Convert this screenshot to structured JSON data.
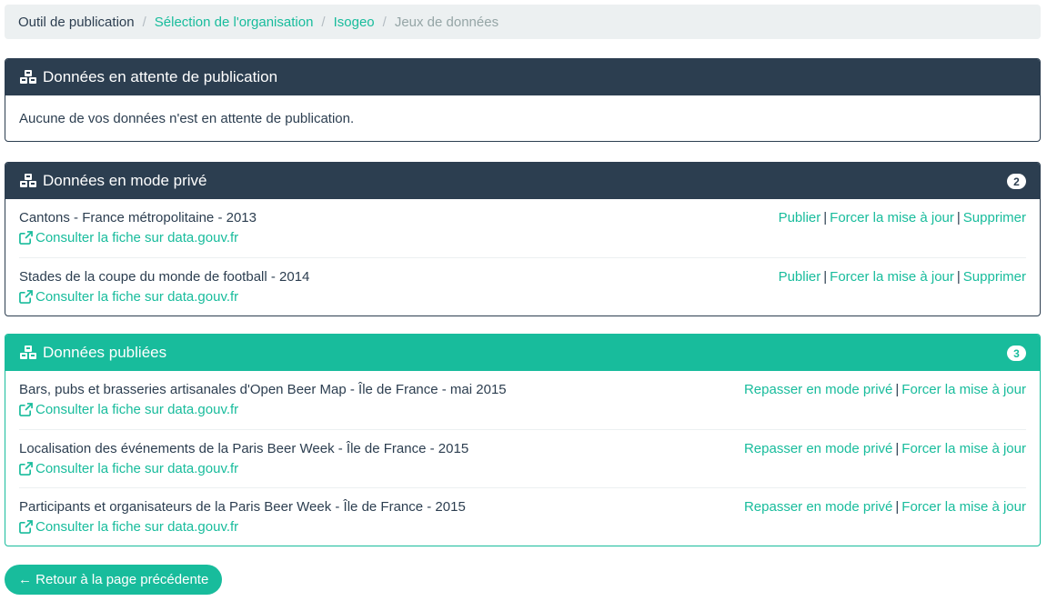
{
  "breadcrumb": [
    {
      "label": "Outil de publication"
    },
    {
      "label": "Sélection de l'organisation"
    },
    {
      "label": "Isogeo"
    },
    {
      "label": "Jeux de données"
    }
  ],
  "pending": {
    "title": "Données en attente de publication",
    "empty_message": "Aucune de vos données n'est en attente de publication."
  },
  "private": {
    "title": "Données en mode privé",
    "count": "2",
    "items": [
      {
        "name": "Cantons - France métropolitaine - 2013",
        "link": "Consulter la fiche sur data.gouv.fr",
        "publish": "Publier",
        "force": "Forcer la mise à jour",
        "delete": "Supprimer"
      },
      {
        "name": "Stades de la coupe du monde de football - 2014",
        "link": "Consulter la fiche sur data.gouv.fr",
        "publish": "Publier",
        "force": "Forcer la mise à jour",
        "delete": "Supprimer"
      }
    ]
  },
  "published": {
    "title": "Données publiées",
    "count": "3",
    "items": [
      {
        "name": "Bars, pubs et brasseries artisanales d'Open Beer Map - Île de France - mai 2015",
        "link": "Consulter la fiche sur data.gouv.fr",
        "private": "Repasser en mode privé",
        "force": "Forcer la mise à jour"
      },
      {
        "name": "Localisation des événements de la Paris Beer Week - Île de France - 2015",
        "link": "Consulter la fiche sur data.gouv.fr",
        "private": "Repasser en mode privé",
        "force": "Forcer la mise à jour"
      },
      {
        "name": "Participants et organisateurs de la Paris Beer Week - Île de France - 2015",
        "link": "Consulter la fiche sur data.gouv.fr",
        "private": "Repasser en mode privé",
        "force": "Forcer la mise à jour"
      }
    ]
  },
  "back_button": "← Retour à la page précédente",
  "colors": {
    "primary": "#2c3e50",
    "success": "#18bc9c",
    "muted": "#95a5a6"
  },
  "icons": {
    "panel": "cubes-icon",
    "link": "external-link-icon"
  }
}
